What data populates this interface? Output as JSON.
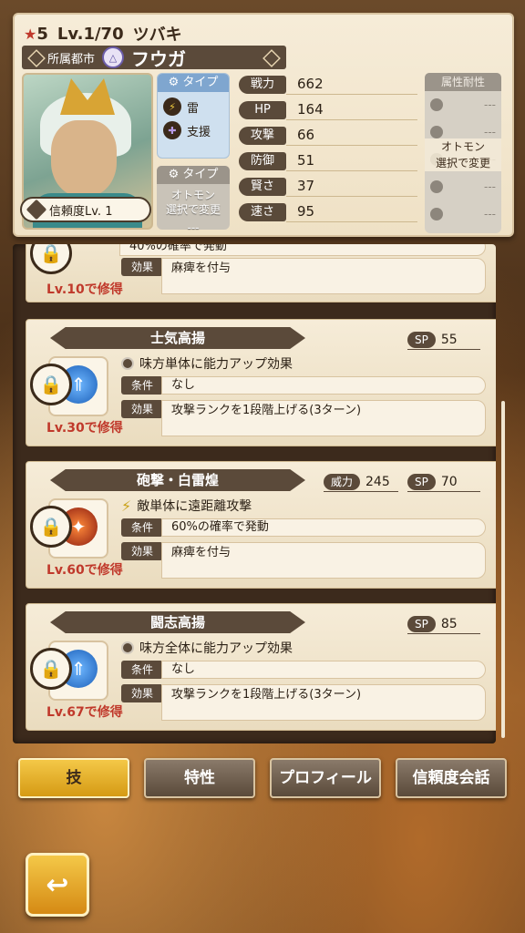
{
  "header": {
    "rarity": "5",
    "level": "Lv.1/70",
    "monster_name": "ツバキ",
    "city_label": "所属都市",
    "city_crest": "△",
    "rider_name": "フウガ",
    "trust_label": "信頼度Lv. 1",
    "type_label": "タイプ",
    "element": "雷",
    "role": "支援",
    "otomon_type_label": "タイプ",
    "otomon_type_text": "オトモン\n選択で変更",
    "otomon_type_dash": "---",
    "resist_label": "属性耐性",
    "resist_dash": "---",
    "resist_overlay": "オトモン\n選択で変更",
    "stats": [
      {
        "label": "戦力",
        "value": "662"
      },
      {
        "label": "HP",
        "value": "164"
      },
      {
        "label": "攻撃",
        "value": "66"
      },
      {
        "label": "防御",
        "value": "51"
      },
      {
        "label": "賢さ",
        "value": "37"
      },
      {
        "label": "速さ",
        "value": "95"
      }
    ]
  },
  "skills": [
    {
      "partial": true,
      "condition_text": "40%の確率で発動",
      "effect_label": "効果",
      "effect_text": "麻痺を付与",
      "learn": "Lv.10で修得"
    },
    {
      "name": "士気高揚",
      "sp_label": "SP",
      "sp": "55",
      "desc": "味方単体に能力アップ効果",
      "condition_label": "条件",
      "condition_text": "なし",
      "effect_label": "効果",
      "effect_text": "攻撃ランクを1段階上げる(3ターン)",
      "learn": "Lv.30で修得"
    },
    {
      "name": "砲撃・白雷煌",
      "power_label": "威力",
      "power": "245",
      "sp_label": "SP",
      "sp": "70",
      "desc": "敵単体に遠距離攻撃",
      "condition_label": "条件",
      "condition_text": "60%の確率で発動",
      "effect_label": "効果",
      "effect_text": "麻痺を付与",
      "learn": "Lv.60で修得"
    },
    {
      "name": "闘志高揚",
      "sp_label": "SP",
      "sp": "85",
      "desc": "味方全体に能力アップ効果",
      "condition_label": "条件",
      "condition_text": "なし",
      "effect_label": "効果",
      "effect_text": "攻撃ランクを1段階上げる(3ターン)",
      "learn": "Lv.67で修得"
    }
  ],
  "tabs": [
    {
      "label": "技",
      "active": true
    },
    {
      "label": "特性",
      "active": false
    },
    {
      "label": "プロフィール",
      "active": false
    },
    {
      "label": "信頼度会話",
      "active": false
    }
  ],
  "colors": {
    "accent": "#d59a14",
    "dark_panel": "#5b4a3a",
    "learn_red": "#c0392b"
  }
}
